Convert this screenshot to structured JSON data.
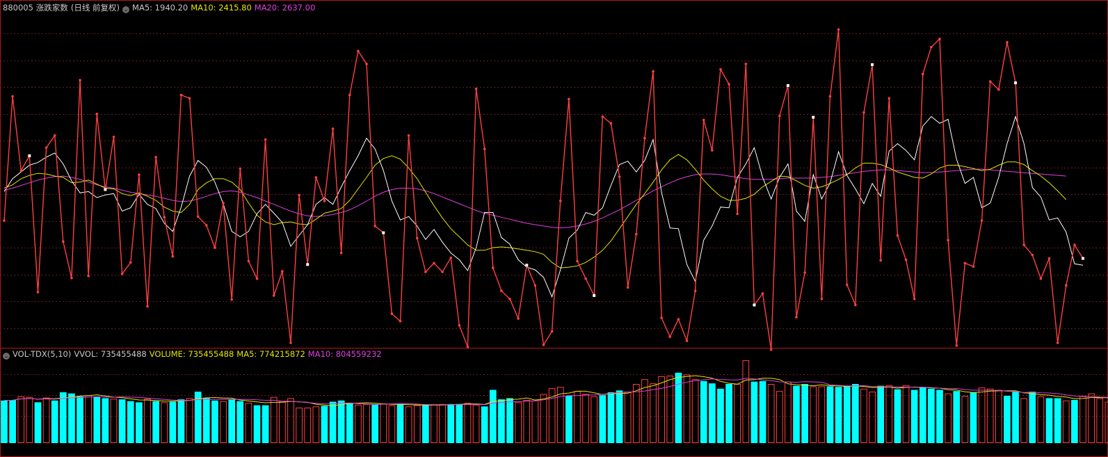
{
  "top_header": {
    "symbol": "880005",
    "name": "涨跌家数",
    "mode": "(日线 前复权)",
    "collapse_glyph": "⌄",
    "ma5_label": "MA5: 1940.20",
    "ma10_label": "MA10: 2415.80",
    "ma20_label": "MA20: 2637.00"
  },
  "vol_header": {
    "collapse_glyph": "⌄",
    "indicator": "VOL-TDX(5,10)",
    "vvol_label": "VVOL: 735455488",
    "volume_label": "VOLUME: 735455488",
    "ma5_label": "MA5: 774215872",
    "ma10_label": "MA10: 804559232"
  },
  "colors": {
    "background": "#000000",
    "frame": "#b01818",
    "grid": "#6e1a1a",
    "line": "#ff4040",
    "ma5": "#ffffff",
    "ma10": "#e6e600",
    "ma20": "#e040e0",
    "up_bar": "#ff4040",
    "down_bar": "#00ffff",
    "text": "#c8c8c8"
  },
  "chart_data": [
    {
      "type": "line",
      "title": "880005 涨跌家数",
      "x_count": 129,
      "ylim": [
        -2200,
        2600
      ],
      "series": [
        {
          "name": "880005",
          "values": [
            -440,
            1400,
            300,
            520,
            -1500,
            640,
            820,
            -750,
            -1290,
            1640,
            -1260,
            1140,
            20,
            800,
            -1230,
            -1060,
            240,
            -1710,
            500,
            -390,
            -970,
            1420,
            1370,
            -380,
            -510,
            -840,
            -180,
            -1610,
            330,
            -1040,
            -1300,
            760,
            -1550,
            -1190,
            -2250,
            -60,
            -1090,
            200,
            -150,
            920,
            -920,
            1420,
            2070,
            1880,
            -520,
            -620,
            -1820,
            -1930,
            820,
            -700,
            -1200,
            -1070,
            -1200,
            -990,
            -1990,
            -2310,
            1510,
            620,
            -1140,
            -1480,
            -1600,
            -1890,
            -1100,
            -1400,
            -2280,
            -2080,
            -150,
            1360,
            -1040,
            -1300,
            -1550,
            1100,
            1000,
            210,
            -1430,
            -640,
            780,
            1770,
            -1880,
            -2160,
            -1900,
            -2220,
            -1480,
            1050,
            600,
            1800,
            1580,
            -340,
            1880,
            -1690,
            -1520,
            -2350,
            1110,
            1560,
            -1870,
            -1210,
            1090,
            -1600,
            1400,
            2390,
            -1390,
            -1690,
            1160,
            1870,
            -1030,
            1370,
            -660,
            -1020,
            -1600,
            1730,
            2130,
            2250,
            -730,
            -2290,
            -1070,
            -1120,
            -440,
            1620,
            1500,
            2200,
            1600,
            -800,
            -950,
            -1300,
            -1000,
            -2250,
            -1400,
            -800,
            -1000
          ]
        },
        {
          "name": "MA5",
          "values": [
            -10,
            180,
            280,
            380,
            420,
            500,
            560,
            400,
            150,
            -30,
            -10,
            -100,
            -60,
            -40,
            -300,
            -250,
            -50,
            -200,
            -260,
            -480,
            -600,
            -240,
            220,
            450,
            350,
            130,
            -190,
            -600,
            -680,
            -600,
            -340,
            -200,
            -330,
            -470,
            -820,
            -660,
            -500,
            -200,
            -100,
            -200,
            60,
            300,
            520,
            780,
            620,
            300,
            -150,
            -430,
            -380,
            -520,
            -720,
            -570,
            -760,
            -920,
            -1020,
            -1180,
            -840,
            -320,
            -320,
            -690,
            -790,
            -1020,
            -1130,
            -1170,
            -1280,
            -1570,
            -1170,
            -700,
            -580,
            -320,
            -360,
            -250,
            80,
            390,
            440,
            280,
            450,
            760,
            -20,
            -550,
            -560,
            -1090,
            -1340,
            -730,
            -520,
            -240,
            -250,
            200,
            400,
            640,
            200,
            -120,
            200,
            400,
            -300,
            -450,
            240,
            -120,
            120,
            580,
            230,
            30,
            -190,
            110,
            -80,
            590,
            700,
            600,
            460,
            960,
            1100,
            1000,
            1060,
            470,
            110,
            200,
            -250,
            -180,
            200,
            700,
            1100,
            700,
            50,
            -90,
            -430,
            -400,
            -610,
            -1080,
            -1100
          ]
        },
        {
          "name": "MA10",
          "values": [
            40,
            90,
            180,
            230,
            260,
            250,
            220,
            200,
            120,
            130,
            160,
            100,
            40,
            30,
            -40,
            -70,
            -30,
            -80,
            -140,
            -240,
            -300,
            -320,
            -200,
            20,
            120,
            180,
            180,
            130,
            20,
            -180,
            -360,
            -460,
            -500,
            -470,
            -460,
            -490,
            -500,
            -420,
            -330,
            -300,
            -260,
            -140,
            30,
            200,
            380,
            480,
            520,
            470,
            340,
            180,
            -20,
            -220,
            -400,
            -560,
            -680,
            -800,
            -880,
            -880,
            -840,
            -830,
            -840,
            -860,
            -880,
            -900,
            -940,
            -1060,
            -1140,
            -1130,
            -1110,
            -1060,
            -980,
            -880,
            -740,
            -560,
            -380,
            -200,
            -40,
            130,
            310,
            460,
            540,
            460,
            320,
            160,
            30,
            -80,
            -140,
            -140,
            -110,
            -50,
            60,
            140,
            220,
            210,
            150,
            80,
            40,
            60,
            110,
            170,
            240,
            340,
            410,
            410,
            390,
            340,
            280,
            240,
            200,
            190,
            250,
            340,
            380,
            380,
            360,
            330,
            300,
            320,
            380,
            430,
            430,
            390,
            300,
            220,
            120,
            0,
            -130
          ]
        },
        {
          "name": "MA20",
          "values": [
            10,
            40,
            80,
            120,
            160,
            190,
            210,
            220,
            200,
            170,
            130,
            90,
            60,
            40,
            10,
            -20,
            -40,
            -60,
            -80,
            -110,
            -140,
            -160,
            -150,
            -120,
            -80,
            -40,
            -10,
            0,
            -20,
            -60,
            -100,
            -150,
            -200,
            -250,
            -300,
            -340,
            -370,
            -380,
            -370,
            -350,
            -320,
            -280,
            -220,
            -150,
            -80,
            -20,
            20,
            40,
            40,
            30,
            0,
            -40,
            -90,
            -140,
            -190,
            -240,
            -290,
            -330,
            -360,
            -390,
            -420,
            -450,
            -480,
            -500,
            -520,
            -540,
            -550,
            -540,
            -520,
            -490,
            -450,
            -400,
            -340,
            -280,
            -210,
            -140,
            -70,
            0,
            60,
            120,
            170,
            210,
            240,
            250,
            250,
            240,
            220,
            200,
            180,
            170,
            170,
            170,
            180,
            190,
            190,
            190,
            190,
            200,
            210,
            230,
            250,
            270,
            290,
            300,
            310,
            310,
            300,
            290,
            280,
            270,
            270,
            280,
            290,
            300,
            310,
            320,
            320,
            310,
            300,
            290,
            280,
            270,
            260,
            250,
            240,
            230,
            220
          ]
        }
      ],
      "markers": [
        3,
        12,
        36,
        45,
        62,
        70,
        89,
        93,
        96,
        103,
        120,
        128
      ]
    },
    {
      "type": "bar",
      "title": "VOL-TDX(5,10)",
      "x_count": 129,
      "ylim": [
        0,
        1400000000
      ],
      "volume_dir": [
        -1,
        -1,
        1,
        1,
        -1,
        1,
        -1,
        -1,
        -1,
        -1,
        1,
        -1,
        -1,
        1,
        -1,
        -1,
        -1,
        1,
        -1,
        1,
        -1,
        -1,
        1,
        -1,
        -1,
        -1,
        1,
        -1,
        -1,
        1,
        -1,
        -1,
        1,
        1,
        1,
        1,
        1,
        1,
        -1,
        -1,
        -1,
        -1,
        1,
        1,
        -1,
        1,
        1,
        -1,
        1,
        1,
        -1,
        1,
        1,
        -1,
        -1,
        1,
        1,
        -1,
        -1,
        -1,
        -1,
        1,
        1,
        1,
        1,
        1,
        1,
        -1,
        1,
        1,
        1,
        -1,
        -1,
        -1,
        1,
        1,
        1,
        1,
        1,
        1,
        -1,
        1,
        1,
        -1,
        -1,
        -1,
        -1,
        1,
        1,
        -1,
        -1,
        1,
        1,
        1,
        -1,
        -1,
        1,
        1,
        -1,
        -1,
        -1,
        -1,
        1,
        1,
        -1,
        1,
        -1,
        1,
        -1,
        -1,
        -1,
        -1,
        1,
        -1,
        1,
        -1,
        1,
        1,
        1,
        -1,
        -1,
        1,
        -1,
        1,
        -1,
        -1,
        1,
        -1,
        1,
        1,
        1
      ],
      "values": [
        720,
        730,
        790,
        780,
        690,
        770,
        720,
        860,
        840,
        790,
        810,
        780,
        760,
        750,
        740,
        710,
        690,
        750,
        710,
        690,
        700,
        740,
        760,
        870,
        760,
        720,
        710,
        740,
        710,
        680,
        640,
        640,
        780,
        710,
        760,
        600,
        600,
        620,
        630,
        700,
        720,
        680,
        650,
        660,
        660,
        670,
        640,
        660,
        620,
        640,
        650,
        650,
        660,
        660,
        660,
        680,
        650,
        620,
        900,
        740,
        760,
        690,
        730,
        720,
        830,
        930,
        950,
        800,
        880,
        830,
        790,
        810,
        860,
        890,
        870,
        1000,
        1080,
        1010,
        1130,
        1140,
        1190,
        1160,
        1080,
        1050,
        1010,
        920,
        1000,
        1000,
        1400,
        1040,
        1050,
        1000,
        880,
        1040,
        970,
        1000,
        960,
        960,
        960,
        950,
        960,
        1000,
        920,
        870,
        970,
        980,
        910,
        980,
        900,
        950,
        920,
        900,
        840,
        880,
        800,
        860,
        940,
        920,
        900,
        800,
        870,
        760,
        870,
        790,
        760,
        760,
        720,
        730,
        800,
        840,
        760,
        700,
        620,
        690,
        700,
        700,
        640
      ]
    }
  ]
}
